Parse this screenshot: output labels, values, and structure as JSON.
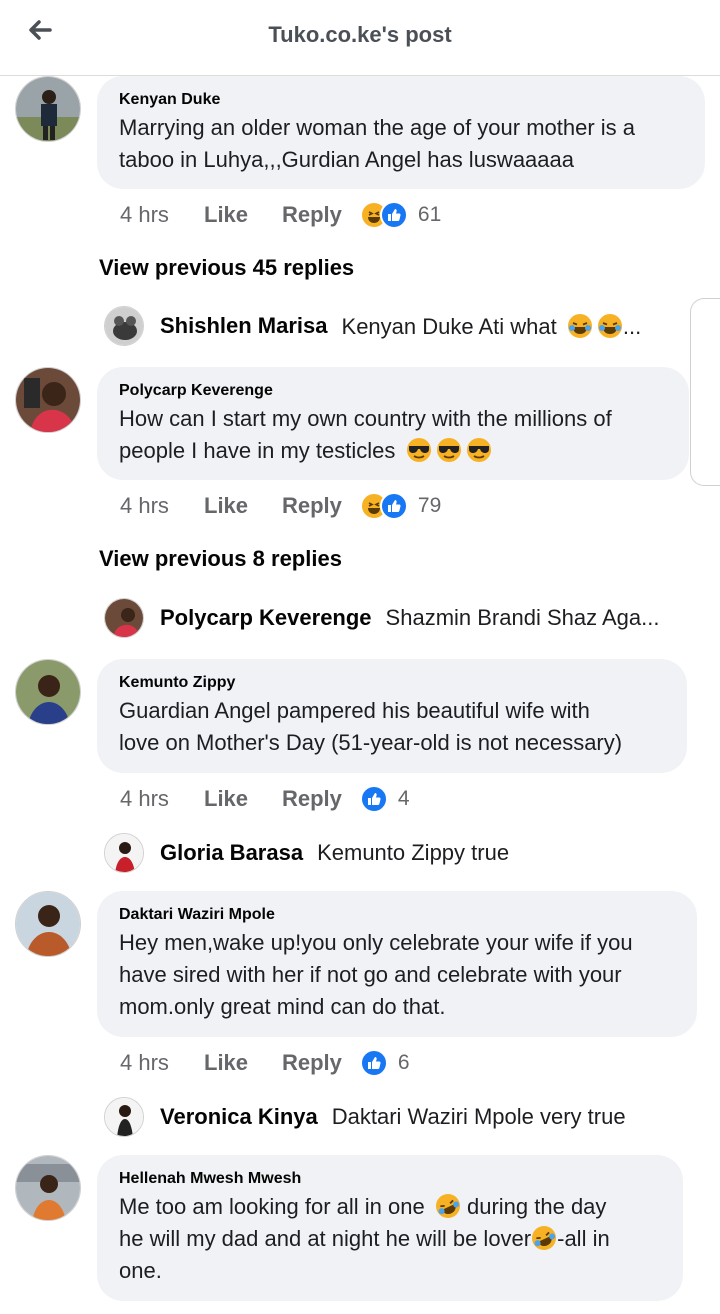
{
  "header": {
    "title": "Tuko.co.ke's post"
  },
  "comments": [
    {
      "author": "Kenyan Duke",
      "line1": "Marrying an older woman the age of your mother is a",
      "line2": "taboo in Luhya,,,Gurdian Angel has luswaaaaa",
      "time": "4 hrs",
      "like": "Like",
      "reply": "Reply",
      "count": "61",
      "reactions": [
        "haha",
        "like"
      ],
      "view_previous": "View previous 45 replies",
      "reply_preview": {
        "author": "Shishlen Marisa",
        "text": "Kenyan Duke Ati what",
        "suffix": "..."
      }
    },
    {
      "author": "Polycarp Keverenge",
      "line1": "How can I start my own country with the millions of",
      "line2": "people I have in my testicles",
      "time": "4 hrs",
      "like": "Like",
      "reply": "Reply",
      "count": "79",
      "reactions": [
        "haha",
        "like"
      ],
      "view_previous": "View previous 8 replies",
      "reply_preview": {
        "author": "Polycarp Keverenge",
        "text": "Shazmin Brandi Shaz Aga..."
      }
    },
    {
      "author": "Kemunto Zippy",
      "line1": "Guardian Angel pampered his beautiful wife with",
      "line2": "love on Mother's Day (51-year-old is not necessary)",
      "time": "4 hrs",
      "like": "Like",
      "reply": "Reply",
      "count": "4",
      "reactions": [
        "like"
      ],
      "reply_preview": {
        "author": "Gloria Barasa",
        "text": "Kemunto Zippy true"
      }
    },
    {
      "author": "Daktari Waziri Mpole",
      "line1": "Hey men,wake up!you only celebrate your wife if you",
      "line2": "have sired with her if not go and celebrate with your",
      "line3": "mom.only great mind can do that.",
      "time": "4 hrs",
      "like": "Like",
      "reply": "Reply",
      "count": "6",
      "reactions": [
        "like"
      ],
      "reply_preview": {
        "author": "Veronica Kinya",
        "text": "Daktari Waziri Mpole very true"
      }
    },
    {
      "author": "Hellenah Mwesh Mwesh",
      "line1a": "Me too am looking for all in one",
      "line1b": "during the day",
      "line2a": "he will my dad and at night he will be lover",
      "line2b": "-all in",
      "line3": "one."
    }
  ],
  "colors": {
    "like_blue": "#1877f2",
    "haha_yellow": "#f7b125",
    "bubble_bg": "#f0f2f5",
    "meta_gray": "#65676b"
  }
}
